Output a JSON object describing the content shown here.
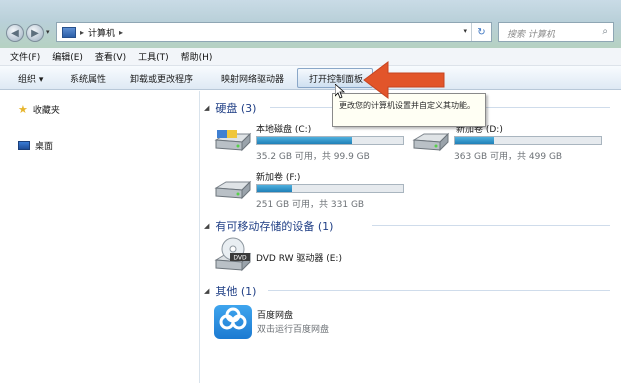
{
  "window": {
    "breadcrumb_sep": "▸",
    "breadcrumb": "计算机",
    "search_placeholder": "搜索 计算机"
  },
  "menubar": [
    "文件(F)",
    "编辑(E)",
    "查看(V)",
    "工具(T)",
    "帮助(H)"
  ],
  "toolbar": {
    "organize": "组织 ▾",
    "system_properties": "系统属性",
    "uninstall": "卸载或更改程序",
    "map_drive": "映射网络驱动器",
    "open_control_panel": "打开控制面板"
  },
  "tooltip": {
    "text": "更改您的计算机设置并自定义其功能。"
  },
  "sidebar": {
    "favorites": "收藏夹",
    "desktop": "桌面"
  },
  "groups": {
    "hdd": {
      "title": "硬盘 (3)"
    },
    "removable": {
      "title": "有可移动存储的设备 (1)"
    },
    "other": {
      "title": "其他 (1)"
    }
  },
  "drives": {
    "c": {
      "name": "本地磁盘 (C:)",
      "free": "35.2 GB 可用，共 99.9 GB",
      "fill_fraction": 0.65
    },
    "d": {
      "name": "新加卷 (D:)",
      "free": "363 GB 可用，共 499 GB",
      "fill_fraction": 0.27
    },
    "f": {
      "name": "新加卷 (F:)",
      "free": "251 GB 可用，共 331 GB",
      "fill_fraction": 0.24
    }
  },
  "dvd": {
    "name": "DVD RW 驱动器 (E:)",
    "icon_label": "DVD"
  },
  "app": {
    "name": "百度网盘",
    "desc": "双击运行百度网盘"
  },
  "colors": {
    "accent": "#1f3e85",
    "bar_fill": "#2b8ac4",
    "arrow": "#e2552a"
  }
}
